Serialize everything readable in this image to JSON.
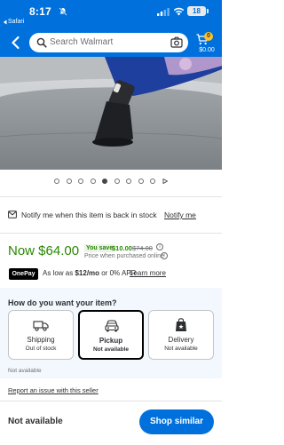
{
  "status_bar": {
    "time": "8:17",
    "battery": "18",
    "back_app": "Safari"
  },
  "header": {
    "search_placeholder": "Search Walmart",
    "cart_count": "0",
    "cart_total": "$0.00"
  },
  "carousel": {
    "dot_count": 9,
    "active_index": 4
  },
  "notify": {
    "text": "Notify me when this item is back in stock",
    "link": "Notify me"
  },
  "pricing": {
    "now": "Now $64.00",
    "you_save_label": "You save",
    "save_amount": "$10.00",
    "was_price": "$74.00",
    "note": "Price when purchased online",
    "info_glyph": "i"
  },
  "onepay": {
    "badge": "OnePay",
    "as_low_prefix": "As low as ",
    "as_low_amount": "$12/mo",
    "as_low_suffix": " or 0% APR",
    "learn_more": "Learn more"
  },
  "fulfillment": {
    "heading": "How do you want your item?",
    "options": [
      {
        "title": "Shipping",
        "status": "Out of stock",
        "icon": "truck-icon",
        "selected": false
      },
      {
        "title": "Pickup",
        "status": "Not available",
        "icon": "car-icon",
        "selected": true
      },
      {
        "title": "Delivery",
        "status": "Not available",
        "icon": "bag-icon",
        "selected": false
      }
    ],
    "availability_note": "Not available"
  },
  "report_link": "Report an issue with this seller",
  "bottom_bar": {
    "status": "Not available",
    "button": "Shop similar"
  },
  "colors": {
    "walmart_blue": "#0071dc",
    "price_green": "#2a8703",
    "spark_yellow": "#ffc220"
  }
}
